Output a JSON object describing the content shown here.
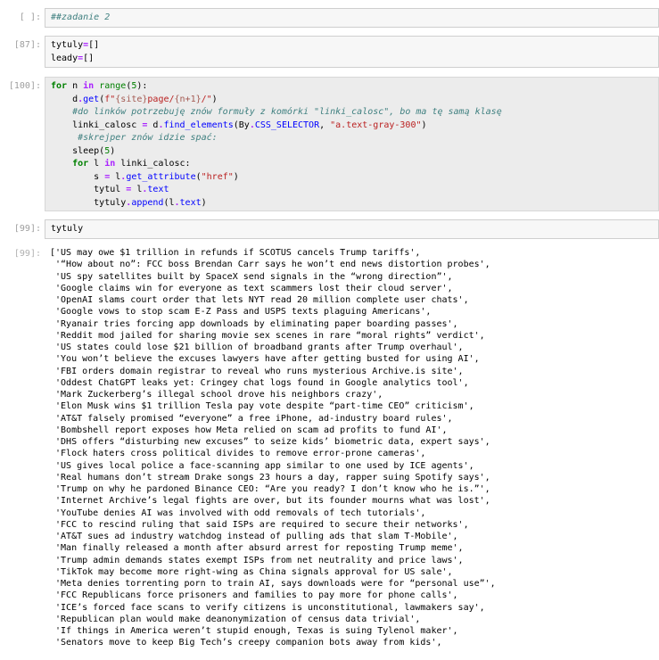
{
  "cells": [
    {
      "prompt": "[ ]:",
      "lines": [
        [
          {
            "t": "##zadanie 2",
            "c": "cm"
          }
        ]
      ]
    },
    {
      "prompt": "[87]:",
      "lines": [
        [
          {
            "t": "tytuly",
            "c": "normal"
          },
          {
            "t": "=",
            "c": "op"
          },
          {
            "t": "[]",
            "c": "normal"
          }
        ],
        [
          {
            "t": "leady",
            "c": "normal"
          },
          {
            "t": "=",
            "c": "op"
          },
          {
            "t": "[]",
            "c": "normal"
          }
        ]
      ]
    },
    {
      "prompt": "[100]:",
      "lines": [
        [
          {
            "t": "for",
            "c": "kw"
          },
          {
            "t": " n ",
            "c": "normal"
          },
          {
            "t": "in",
            "c": "op"
          },
          {
            "t": " ",
            "c": "normal"
          },
          {
            "t": "range",
            "c": "bi"
          },
          {
            "t": "(",
            "c": "normal"
          },
          {
            "t": "5",
            "c": "num"
          },
          {
            "t": "):",
            "c": "normal"
          }
        ],
        [
          {
            "t": "    d",
            "c": "normal"
          },
          {
            "t": ".",
            "c": "op"
          },
          {
            "t": "get",
            "c": "fn"
          },
          {
            "t": "(",
            "c": "normal"
          },
          {
            "t": "f\"",
            "c": "str"
          },
          {
            "t": "{site}",
            "c": "sp"
          },
          {
            "t": "page/",
            "c": "str"
          },
          {
            "t": "{n+1}",
            "c": "sp"
          },
          {
            "t": "/\"",
            "c": "str"
          },
          {
            "t": ")",
            "c": "normal"
          }
        ],
        [
          {
            "t": "    #do linków potrzebuję znów formuły z komórki \"linki_calosc\", bo ma tę samą klasę",
            "c": "cm"
          }
        ],
        [
          {
            "t": "    linki_calosc ",
            "c": "normal"
          },
          {
            "t": "=",
            "c": "op"
          },
          {
            "t": " d",
            "c": "normal"
          },
          {
            "t": ".",
            "c": "op"
          },
          {
            "t": "find_elements",
            "c": "fn"
          },
          {
            "t": "(By",
            "c": "normal"
          },
          {
            "t": ".",
            "c": "op"
          },
          {
            "t": "CSS_SELECTOR",
            "c": "at"
          },
          {
            "t": ", ",
            "c": "normal"
          },
          {
            "t": "\"a.text-gray-300\"",
            "c": "str"
          },
          {
            "t": ")",
            "c": "normal"
          }
        ],
        [
          {
            "t": "     #skrejper znów idzie spać:",
            "c": "cm"
          }
        ],
        [
          {
            "t": "    sleep(",
            "c": "normal"
          },
          {
            "t": "5",
            "c": "num"
          },
          {
            "t": ")",
            "c": "normal"
          }
        ],
        [
          {
            "t": "    ",
            "c": "normal"
          },
          {
            "t": "for",
            "c": "kw"
          },
          {
            "t": " l ",
            "c": "normal"
          },
          {
            "t": "in",
            "c": "op"
          },
          {
            "t": " linki_calosc:",
            "c": "normal"
          }
        ],
        [
          {
            "t": "        s ",
            "c": "normal"
          },
          {
            "t": "=",
            "c": "op"
          },
          {
            "t": " l",
            "c": "normal"
          },
          {
            "t": ".",
            "c": "op"
          },
          {
            "t": "get_attribute",
            "c": "fn"
          },
          {
            "t": "(",
            "c": "normal"
          },
          {
            "t": "\"href\"",
            "c": "str"
          },
          {
            "t": ")",
            "c": "normal"
          }
        ],
        [
          {
            "t": "        tytul ",
            "c": "normal"
          },
          {
            "t": "=",
            "c": "op"
          },
          {
            "t": " l",
            "c": "normal"
          },
          {
            "t": ".",
            "c": "op"
          },
          {
            "t": "text",
            "c": "at"
          }
        ],
        [
          {
            "t": "        tytuly",
            "c": "normal"
          },
          {
            "t": ".",
            "c": "op"
          },
          {
            "t": "append",
            "c": "fn"
          },
          {
            "t": "(l",
            "c": "normal"
          },
          {
            "t": ".",
            "c": "op"
          },
          {
            "t": "text",
            "c": "at"
          },
          {
            "t": ")",
            "c": "normal"
          }
        ]
      ]
    },
    {
      "prompt": "[99]:",
      "lines": [
        [
          {
            "t": "tytuly",
            "c": "normal"
          }
        ]
      ]
    }
  ],
  "output": {
    "prompt": "[99]:",
    "lines": [
      "['US may owe $1 trillion in refunds if SCOTUS cancels Trump tariffs',",
      " '“How about no”: FCC boss Brendan Carr says he won’t end news distortion probes',",
      " 'US spy satellites built by SpaceX send signals in the “wrong direction”',",
      " 'Google claims win for everyone as text scammers lost their cloud server',",
      " 'OpenAI slams court order that lets NYT read 20 million complete user chats',",
      " 'Google vows to stop scam E-Z Pass and USPS texts plaguing Americans',",
      " 'Ryanair tries forcing app downloads by eliminating paper boarding passes',",
      " 'Reddit mod jailed for sharing movie sex scenes in rare “moral rights” verdict',",
      " 'US states could lose $21 billion of broadband grants after Trump overhaul',",
      " 'You won’t believe the excuses lawyers have after getting busted for using AI',",
      " 'FBI orders domain registrar to reveal who runs mysterious Archive.is site',",
      " 'Oddest ChatGPT leaks yet: Cringey chat logs found in Google analytics tool',",
      " 'Mark Zuckerberg’s illegal school drove his neighbors crazy',",
      " 'Elon Musk wins $1 trillion Tesla pay vote despite “part-time CEO” criticism',",
      " 'AT&T falsely promised “everyone” a free iPhone, ad-industry board rules',",
      " 'Bombshell report exposes how Meta relied on scam ad profits to fund AI',",
      " 'DHS offers “disturbing new excuses” to seize kids’ biometric data, expert says',",
      " 'Flock haters cross political divides to remove error-prone cameras',",
      " 'US gives local police a face-scanning app similar to one used by ICE agents',",
      " 'Real humans don’t stream Drake songs 23 hours a day, rapper suing Spotify says',",
      " 'Trump on why he pardoned Binance CEO: “Are you ready? I don’t know who he is.”',",
      " 'Internet Archive’s legal fights are over, but its founder mourns what was lost',",
      " 'YouTube denies AI was involved with odd removals of tech tutorials',",
      " 'FCC to rescind ruling that said ISPs are required to secure their networks',",
      " 'AT&T sues ad industry watchdog instead of pulling ads that slam T-Mobile',",
      " 'Man finally released a month after absurd arrest for reposting Trump meme',",
      " 'Trump admin demands states exempt ISPs from net neutrality and price laws',",
      " 'TikTok may become more right-wing as China signals approval for US sale',",
      " 'Meta denies torrenting porn to train AI, says downloads were for “personal use”',",
      " 'FCC Republicans force prisoners and families to pay more for phone calls',",
      " 'ICE’s forced face scans to verify citizens is unconstitutional, lawmakers say',",
      " 'Republican plan would make deanonymization of census data trivial',",
      " 'If things in America weren’t stupid enough, Texas is suing Tylenol maker',",
      " 'Senators move to keep Big Tech’s creepy companion bots away from kids',"
    ]
  }
}
